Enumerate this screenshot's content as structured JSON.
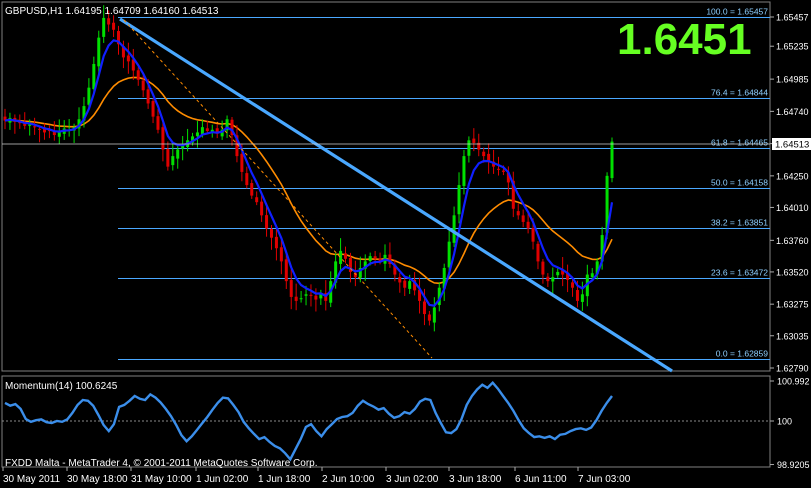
{
  "header": {
    "symbol_info": "GBPUSD,H1  1.64195 1.64709 1.64160 1.64513",
    "big_price": "1.6451",
    "footer": "FXDD Malta - MetaTrader 4, © 2001-2011 MetaQuotes Software Corp."
  },
  "colors": {
    "background": "#000000",
    "bull": "#00e000",
    "bear": "#e00000",
    "ma_fast": "#1020ff",
    "ma_slow": "#ff8c00",
    "trendline": "#4aa8ff",
    "fib": "#4aa8ff",
    "momentum": "#3b8eea",
    "big_price": "#66ff22"
  },
  "chart_data": [
    {
      "type": "candlestick",
      "title": "GBPUSD,H1",
      "price_axis_ticks": [
        "1.65457",
        "1.65235",
        "1.64985",
        "1.64740",
        "1.64495",
        "1.64250",
        "1.64010",
        "1.63760",
        "1.63520",
        "1.63275",
        "1.63035",
        "1.62790"
      ],
      "current_price_label": "1.64513",
      "ylim": [
        1.6277,
        1.6553
      ],
      "time_axis_ticks": [
        "30 May 2011",
        "30 May 18:00",
        "31 May 10:00",
        "1 Jun 02:00",
        "1 Jun 18:00",
        "2 Jun 10:00",
        "3 Jun 02:00",
        "3 Jun 18:00",
        "6 Jun 11:00",
        "7 Jun 03:00"
      ],
      "fibonacci": [
        {
          "label": "100.0 = 1.65457",
          "value": 1.65457
        },
        {
          "label": "76.4 = 1.64844",
          "value": 1.64844
        },
        {
          "label": "61.8 = 1.64465",
          "value": 1.64465
        },
        {
          "label": "50.0 = 1.64158",
          "value": 1.64158
        },
        {
          "label": "38.2 = 1.63851",
          "value": 1.63851
        },
        {
          "label": "23.6 = 1.63472",
          "value": 1.63472
        },
        {
          "label": "0.0 = 1.62859",
          "value": 1.62859
        }
      ],
      "series": [
        {
          "name": "close",
          "values": [
            1.6467,
            1.6469,
            1.6466,
            1.6465,
            1.6463,
            1.6464,
            1.6462,
            1.646,
            1.6458,
            1.6459,
            1.6456,
            1.6458,
            1.6461,
            1.646,
            1.6462,
            1.6468,
            1.6478,
            1.6492,
            1.651,
            1.653,
            1.6545,
            1.654,
            1.6536,
            1.6525,
            1.6515,
            1.6512,
            1.6505,
            1.6498,
            1.649,
            1.648,
            1.647,
            1.646,
            1.6445,
            1.6432,
            1.644,
            1.6445,
            1.6448,
            1.6452,
            1.6455,
            1.6458,
            1.6462,
            1.6459,
            1.646,
            1.6457,
            1.646,
            1.6468,
            1.6456,
            1.644,
            1.6428,
            1.6418,
            1.641,
            1.6405,
            1.6395,
            1.6385,
            1.6378,
            1.637,
            1.636,
            1.6345,
            1.6333,
            1.633,
            1.6332,
            1.6335,
            1.6334,
            1.6331,
            1.6336,
            1.633,
            1.6345,
            1.636,
            1.6368,
            1.6362,
            1.6352,
            1.6348,
            1.6355,
            1.636,
            1.6364,
            1.6362,
            1.636,
            1.6365,
            1.6358,
            1.635,
            1.6344,
            1.634,
            1.6345,
            1.6338,
            1.633,
            1.632,
            1.6315,
            1.6325,
            1.634,
            1.6355,
            1.6375,
            1.6395,
            1.6418,
            1.644,
            1.6452,
            1.645,
            1.6445,
            1.644,
            1.6436,
            1.6432,
            1.643,
            1.6428,
            1.642,
            1.64,
            1.6395,
            1.639,
            1.6385,
            1.6375,
            1.636,
            1.635,
            1.6345,
            1.6348,
            1.6352,
            1.635,
            1.6346,
            1.634,
            1.633,
            1.6335,
            1.635,
            1.6351,
            1.636,
            1.638,
            1.6425,
            1.6451
          ]
        },
        {
          "name": "Moving Average (fast)",
          "color": "blue"
        },
        {
          "name": "Moving Average (slow)",
          "color": "orange"
        }
      ]
    },
    {
      "type": "line",
      "title": "Momentum(14) 100.6245",
      "y_axis_ticks": [
        "100.992",
        "100",
        "98.9205"
      ],
      "ylim": [
        98.9205,
        100.992
      ],
      "series": [
        {
          "name": "Momentum(14)",
          "values": [
            100.45,
            100.38,
            100.42,
            100.3,
            100.05,
            99.98,
            100.02,
            100.04,
            99.97,
            99.95,
            100.0,
            99.98,
            100.04,
            100.2,
            100.4,
            100.52,
            100.5,
            100.38,
            100.15,
            99.9,
            99.75,
            99.92,
            100.35,
            100.4,
            100.5,
            100.62,
            100.55,
            100.52,
            100.66,
            100.58,
            100.46,
            100.3,
            100.12,
            99.9,
            99.65,
            99.5,
            99.62,
            99.78,
            99.94,
            100.1,
            100.28,
            100.45,
            100.58,
            100.56,
            100.4,
            100.22,
            99.98,
            99.82,
            99.68,
            99.55,
            99.6,
            99.48,
            99.38,
            99.32,
            99.2,
            99.05,
            99.3,
            99.55,
            99.85,
            99.92,
            99.75,
            99.62,
            99.8,
            99.92,
            100.05,
            100.1,
            100.12,
            100.2,
            100.38,
            100.5,
            100.42,
            100.36,
            100.28,
            100.32,
            100.18,
            100.08,
            100.12,
            100.22,
            100.18,
            100.3,
            100.48,
            100.55,
            100.52,
            100.2,
            99.95,
            99.72,
            99.7,
            99.8,
            100.05,
            100.4,
            100.62,
            100.78,
            100.9,
            100.82,
            100.95,
            100.8,
            100.62,
            100.45,
            100.25,
            100.02,
            99.82,
            99.7,
            99.6,
            99.62,
            99.58,
            99.62,
            99.55,
            99.66,
            99.68,
            99.75,
            99.8,
            99.82,
            99.78,
            99.84,
            100.02,
            100.25,
            100.45,
            100.62
          ]
        }
      ]
    }
  ]
}
